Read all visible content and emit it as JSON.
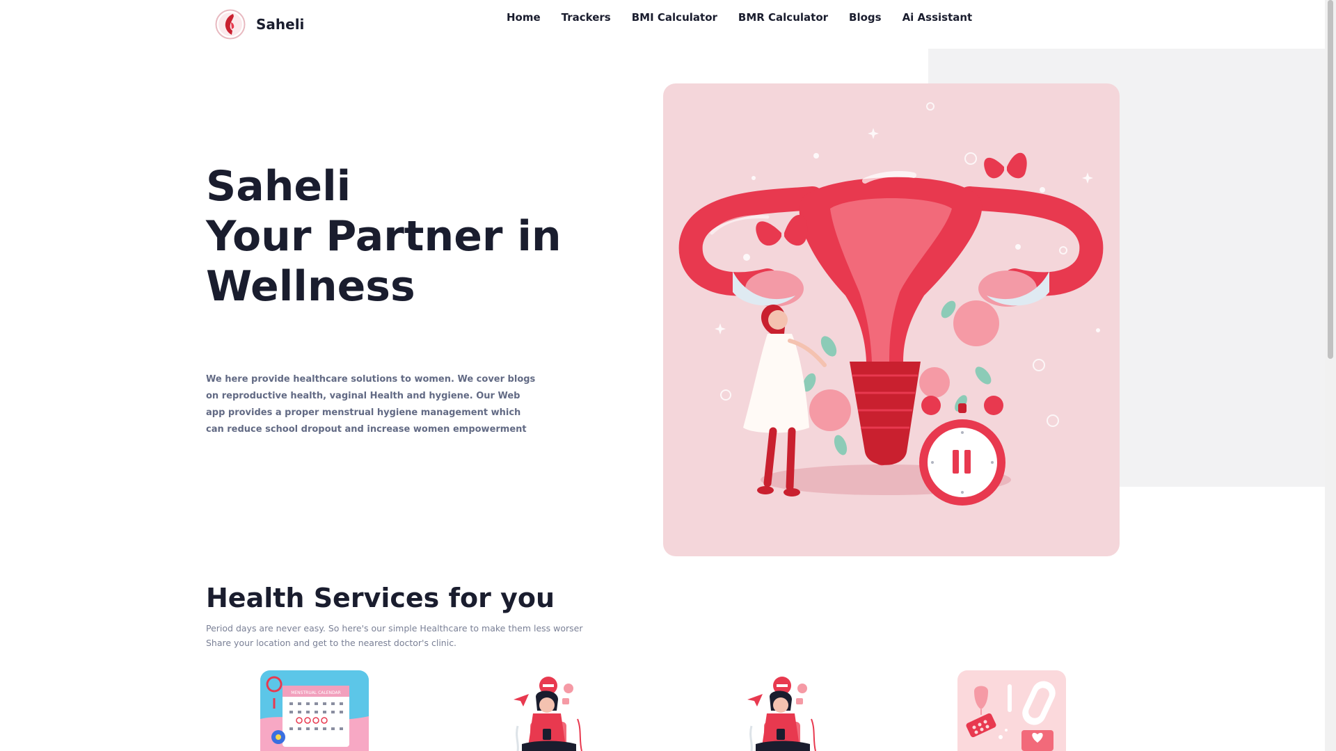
{
  "brand": {
    "name": "Saheli",
    "logo_icon": "woman-profile-logo-icon"
  },
  "nav": {
    "items": [
      {
        "label": "Home"
      },
      {
        "label": "Trackers"
      },
      {
        "label": "BMI Calculator"
      },
      {
        "label": "BMR Calculator"
      },
      {
        "label": "Blogs"
      },
      {
        "label": "Ai Assistant"
      }
    ]
  },
  "hero": {
    "title_line1": "Saheli",
    "title_line2": "Your Partner in",
    "title_line3": "Wellness",
    "description": "We here provide healthcare solutions to women. We cover blogs on reproductive health, vaginal Health and hygiene. Our Web app provides a proper menstrual hygiene management which can reduce school dropout and increase women empowerment",
    "illustration": "uterus-woman-clock-illustration"
  },
  "services": {
    "title": "Health Services for you",
    "subtitle_line1": "Period days are never easy. So here's our simple Healthcare to make them less worser",
    "subtitle_line2": "Share your location and get to the nearest doctor's clinic.",
    "cards": [
      {
        "icon": "menstrual-calendar-icon",
        "calendar_label": "MENSTRUAL CALENDAR"
      },
      {
        "icon": "woman-with-phone-icon"
      },
      {
        "icon": "woman-with-phone-icon"
      },
      {
        "icon": "hygiene-products-icon"
      }
    ]
  },
  "colors": {
    "accent": "#e8394f",
    "hero_panel": "#f4d6da",
    "text_dark": "#1a1d2e",
    "text_muted": "#626a84"
  }
}
